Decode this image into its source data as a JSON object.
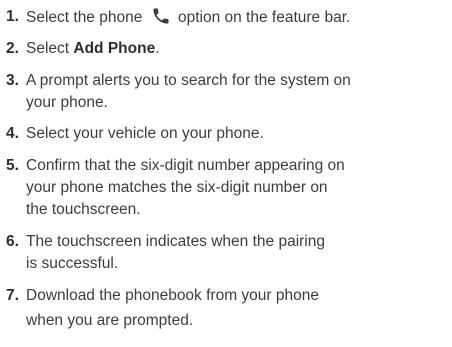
{
  "steps": [
    {
      "number": "1.",
      "before_icon": "Select the phone",
      "icon": "phone-icon",
      "after_icon": "option on the feature bar."
    },
    {
      "number": "2.",
      "prefix": "Select ",
      "bold": "Add Phone",
      "suffix": "."
    },
    {
      "number": "3.",
      "lines": [
        "A prompt alerts you to search for the system on",
        "your phone."
      ]
    },
    {
      "number": "4.",
      "lines": [
        "Select your vehicle on your phone."
      ]
    },
    {
      "number": "5.",
      "lines": [
        "Confirm that the six-digit number appearing on",
        "your phone matches the six-digit number on",
        "the touchscreen."
      ]
    },
    {
      "number": "6.",
      "lines": [
        "The touchscreen indicates when the pairing",
        "is successful."
      ]
    },
    {
      "number": "7.",
      "lines": [
        "Download the phonebook from your phone",
        "when you are prompted."
      ]
    }
  ]
}
